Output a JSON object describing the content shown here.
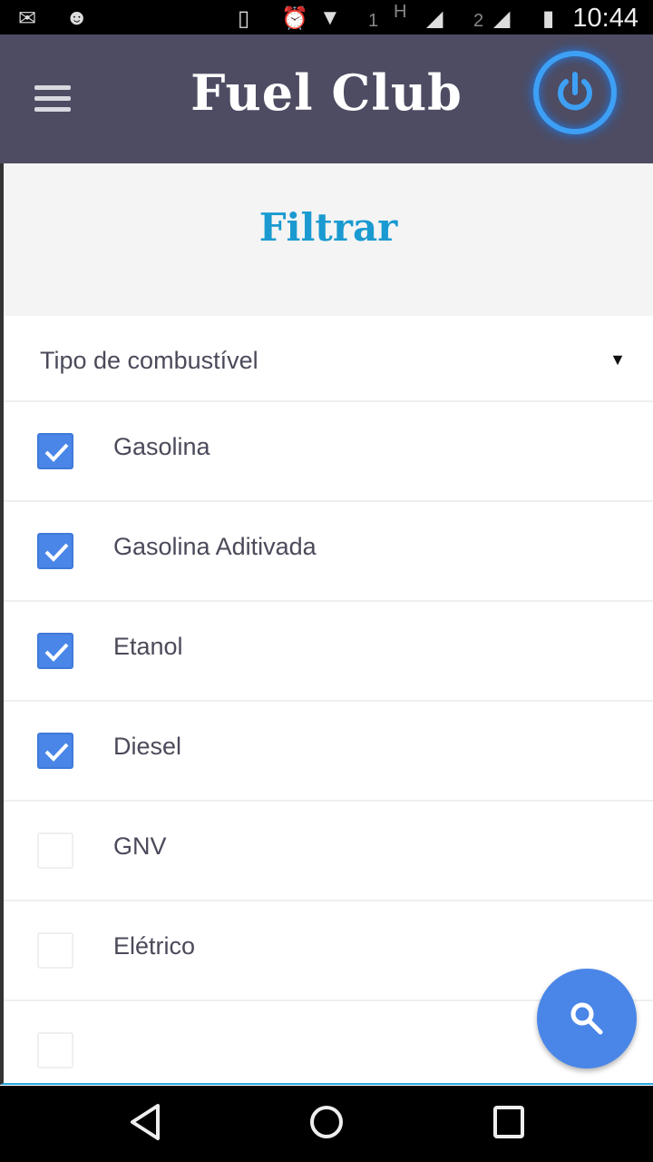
{
  "status_bar": {
    "time": "10:44",
    "sim1": "1",
    "sim2": "2",
    "network": "H"
  },
  "app_bar": {
    "title": "Fuel Club"
  },
  "filter": {
    "title": "Filtrar",
    "dropdown_label": "Tipo de combustível",
    "options": [
      {
        "label": "Gasolina",
        "checked": true
      },
      {
        "label": "Gasolina Aditivada",
        "checked": true
      },
      {
        "label": "Etanol",
        "checked": true
      },
      {
        "label": "Diesel",
        "checked": true
      },
      {
        "label": "GNV",
        "checked": false
      },
      {
        "label": "Elétrico",
        "checked": false
      },
      {
        "label": "",
        "checked": false
      }
    ]
  },
  "colors": {
    "appbar": "#4d4c63",
    "accent": "#1a9ad0",
    "checkbox": "#4a86e8"
  }
}
